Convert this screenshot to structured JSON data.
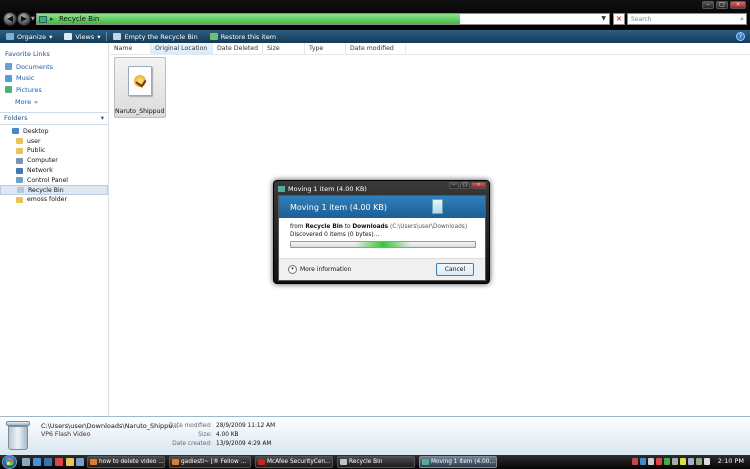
{
  "address": {
    "path": "Recycle Bin"
  },
  "search": {
    "placeholder": "Search"
  },
  "toolbar": {
    "organize": "Organize",
    "views": "Views",
    "empty_bin": "Empty the Recycle Bin",
    "restore": "Restore this item"
  },
  "navpane": {
    "favorites_title": "Favorite Links",
    "favorites": [
      "Documents",
      "Music",
      "Pictures"
    ],
    "more": "More",
    "folders_title": "Folders",
    "tree": [
      "Desktop",
      "user",
      "Public",
      "Computer",
      "Network",
      "Control Panel",
      "Recycle Bin",
      "emoss folder"
    ]
  },
  "columns": [
    "Name",
    "Original Location",
    "Date Deleted",
    "Size",
    "Type",
    "Date modified"
  ],
  "file": {
    "name": "Naruto_Shippud..."
  },
  "dialog": {
    "title": "Moving 1 item (4.00 KB)",
    "heading": "Moving 1 item (4.00 KB)",
    "from_label": "from",
    "from_name": "Recycle Bin",
    "to_label": "to",
    "to_name": "Downloads",
    "to_path": "(C:\\Users\\user\\Downloads)",
    "discovered": "Discovered 0 items (0 bytes)...",
    "more_info": "More information",
    "cancel": "Cancel"
  },
  "details": {
    "name": "C:\\Users\\user\\Downloads\\Naruto_Shippu...",
    "type": "VP6 Flash Video",
    "modified_label": "Date modified:",
    "modified_value": "28/9/2009 11:12 AM",
    "size_label": "Size:",
    "size_value": "4.00 KB",
    "created_label": "Date created:",
    "created_value": "13/9/2009 4:29 AM"
  },
  "taskbar": {
    "tasks": [
      "how to delete video ...",
      "gadiesti~ [® Fellow ...",
      "McAfee SecurityCen...",
      "Recycle Bin",
      "Moving 1 item (4.00..."
    ],
    "clock": "2:10 PM"
  },
  "colors": {
    "toolbar": "#1e4b6e",
    "progress_green": "#3fb93f",
    "dialog_header": "#2a75b0"
  }
}
